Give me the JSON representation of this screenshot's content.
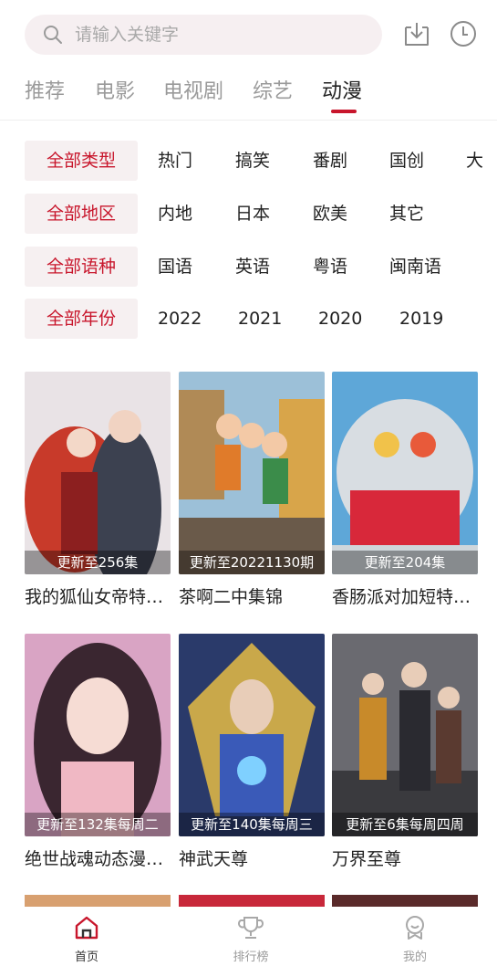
{
  "search": {
    "placeholder": "请输入关键字"
  },
  "header_icons": [
    "download-icon",
    "history-clock-icon"
  ],
  "tabs": [
    {
      "label": "推荐",
      "active": false
    },
    {
      "label": "电影",
      "active": false
    },
    {
      "label": "电视剧",
      "active": false
    },
    {
      "label": "综艺",
      "active": false
    },
    {
      "label": "动漫",
      "active": true
    }
  ],
  "filters": {
    "type": {
      "head": "全部类型",
      "options": [
        "热门",
        "搞笑",
        "番剧",
        "国创",
        "大"
      ]
    },
    "region": {
      "head": "全部地区",
      "options": [
        "内地",
        "日本",
        "欧美",
        "其它"
      ]
    },
    "language": {
      "head": "全部语种",
      "options": [
        "国语",
        "英语",
        "粤语",
        "闽南语"
      ]
    },
    "year": {
      "head": "全部年份",
      "options": [
        "2022",
        "2021",
        "2020",
        "2019"
      ]
    }
  },
  "grid": [
    {
      "title": "我的狐仙女帝特…",
      "badge": "更新至256集"
    },
    {
      "title": "茶啊二中集锦",
      "badge": "更新至20221130期"
    },
    {
      "title": "香肠派对加短特…",
      "badge": "更新至204集"
    },
    {
      "title": "绝世战魂动态漫…",
      "badge": "更新至132集每周二"
    },
    {
      "title": "神武天尊",
      "badge": "更新至140集每周三"
    },
    {
      "title": "万界至尊",
      "badge": "更新至6集每周四周"
    }
  ],
  "bottom_nav": [
    {
      "label": "首页",
      "icon": "home-icon",
      "active": true
    },
    {
      "label": "排行榜",
      "icon": "trophy-icon",
      "active": false
    },
    {
      "label": "我的",
      "icon": "profile-icon",
      "active": false
    }
  ],
  "colors": {
    "accent": "#c8162c",
    "search_bg": "#f6eff1",
    "filter_head_bg": "#f6f0f1",
    "inactive_text": "#9a9a9a"
  }
}
